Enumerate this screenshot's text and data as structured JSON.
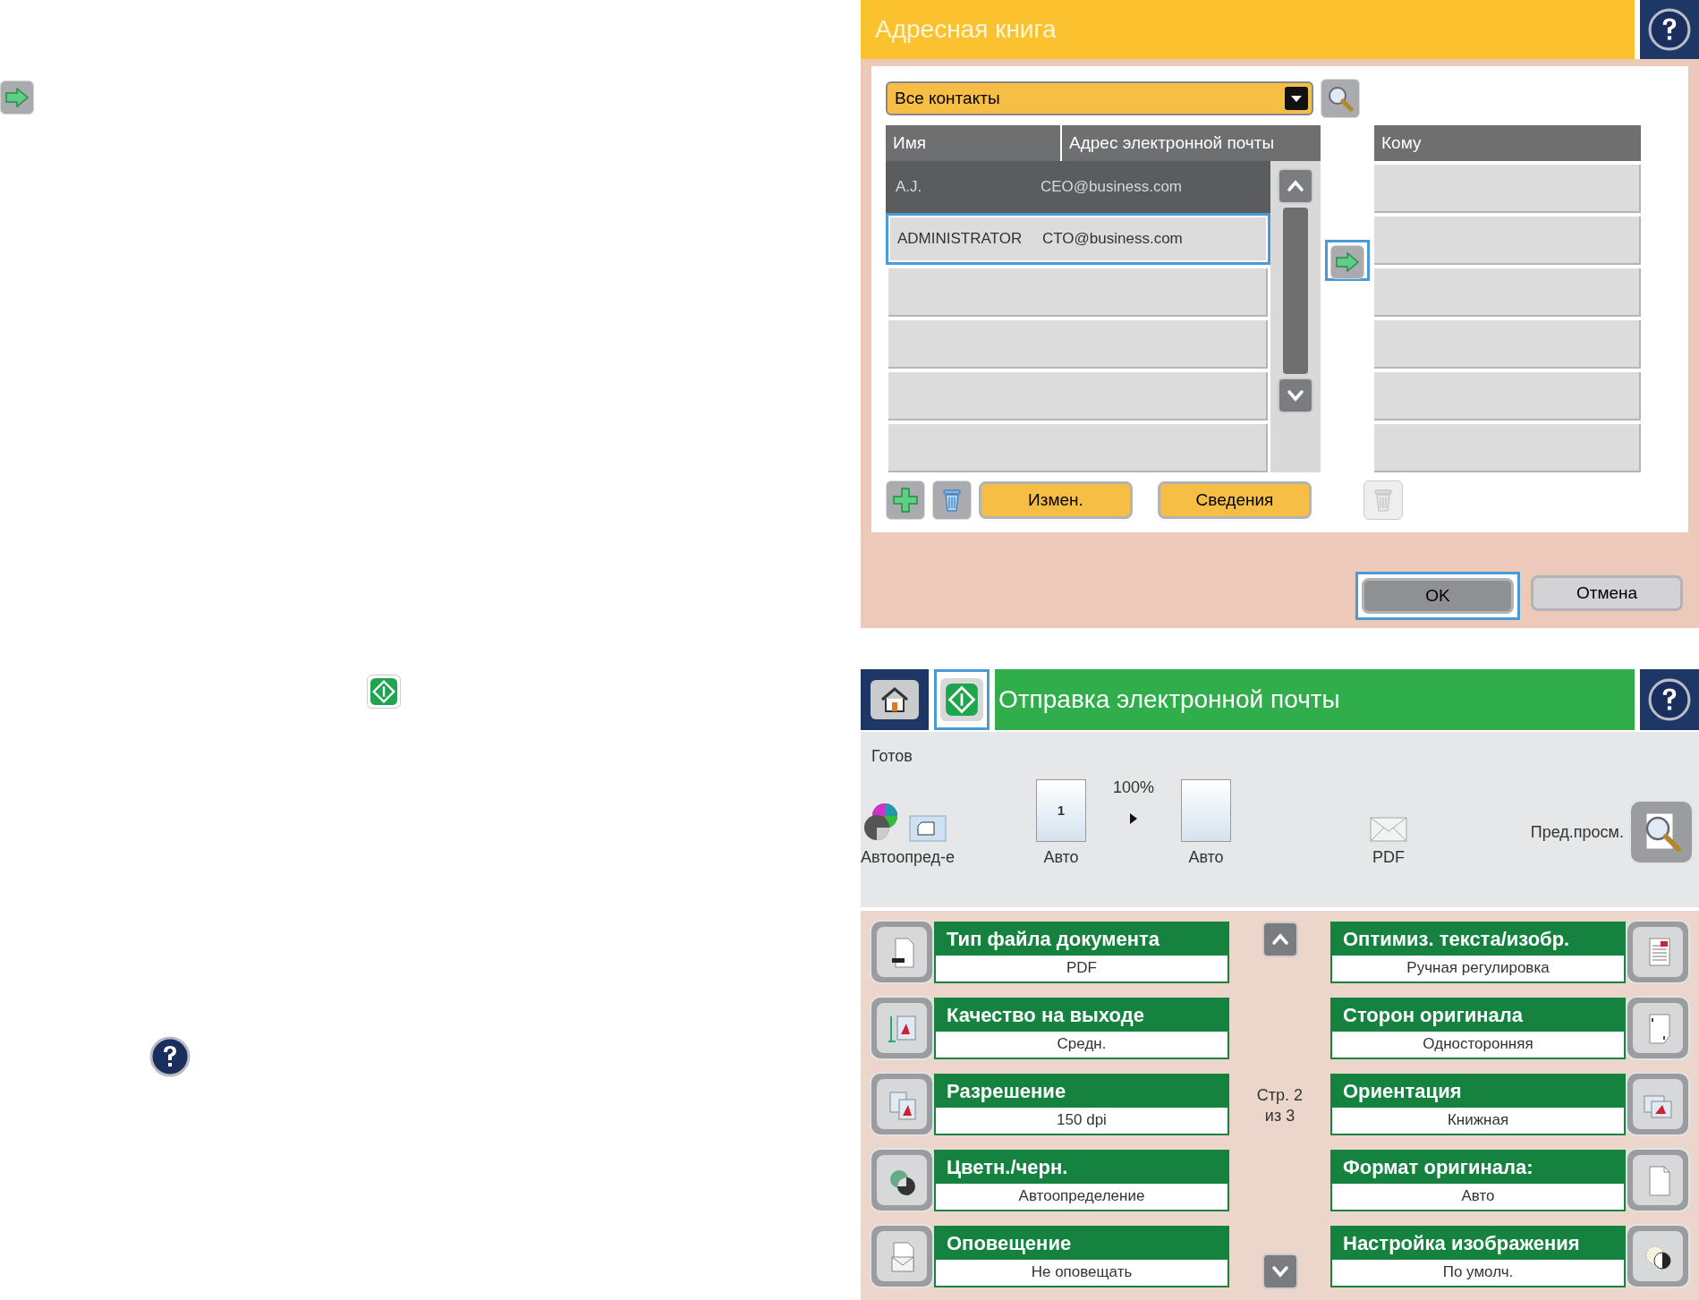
{
  "address_book": {
    "title": "Адресная книга",
    "filter": "Все контакты",
    "columns": [
      "Имя",
      "Адрес электронной почты"
    ],
    "contacts": [
      {
        "name": "A.J.",
        "email": "CEO@business.com",
        "selected": true,
        "highlighted": false
      },
      {
        "name": "ADMINISTRATOR",
        "email": "CTO@business.com",
        "selected": false,
        "highlighted": true
      }
    ],
    "transfer_button": {
      "highlighted": true
    },
    "recipients_header": "Кому",
    "edit_button": "Измен.",
    "details_button": "Сведения",
    "remove_recipient_button": {
      "disabled": true
    },
    "ok_button": {
      "label": "OK",
      "highlighted": true
    },
    "cancel_button": {
      "label": "Отмена",
      "highlighted": false
    }
  },
  "email_screen": {
    "title": "Отправка электронной почты",
    "start_button": {
      "highlighted": true
    },
    "status": "Готов",
    "color_mode": "Автоопред-е",
    "original_page": "1",
    "original_size": "Авто",
    "scale": "100%",
    "output_size": "Авто",
    "file_format": "PDF",
    "preview_label": "Пред.просм.",
    "page_indicator": "Стр. 2 из 3",
    "settings_left": [
      {
        "title": "Тип файла документа",
        "value": "PDF"
      },
      {
        "title": "Качество на выходе",
        "value": "Средн."
      },
      {
        "title": "Разрешение",
        "value": "150 dpi"
      },
      {
        "title": "Цветн./черн.",
        "value": "Автоопределение"
      },
      {
        "title": "Оповещение",
        "value": "Не оповещать"
      }
    ],
    "settings_right": [
      {
        "title": "Оптимиз. текста/изобр.",
        "value": "Ручная регулировка"
      },
      {
        "title": "Сторон оригинала",
        "value": "Односторонняя"
      },
      {
        "title": "Ориентация",
        "value": "Книжная"
      },
      {
        "title": "Формат оригинала:",
        "value": "Авто"
      },
      {
        "title": "Настройка изображения",
        "value": "По умолч."
      }
    ]
  }
}
